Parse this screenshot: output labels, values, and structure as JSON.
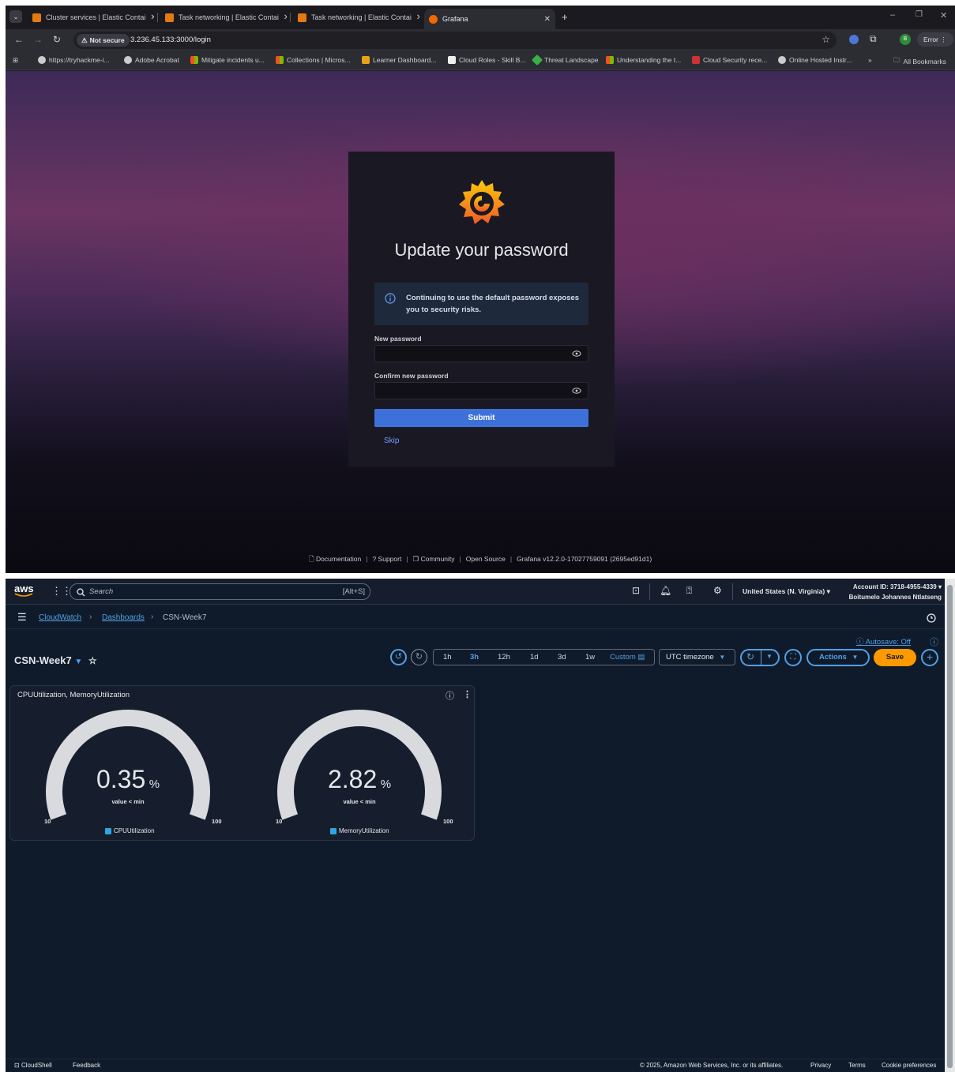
{
  "browser": {
    "tabs": [
      {
        "title": "Cluster services | Elastic Contai",
        "active": false
      },
      {
        "title": "Task networking | Elastic Contai",
        "active": false
      },
      {
        "title": "Task networking | Elastic Contai",
        "active": false
      },
      {
        "title": "Grafana",
        "active": true
      }
    ],
    "new_tab": "+",
    "address": {
      "security_label": "Not secure",
      "url": "3.236.45.133:3000/login"
    },
    "profile_initial": "B",
    "error_label": "Error",
    "bookmarks": [
      "https://tryhackme-i...",
      "Adobe Acrobat",
      "Mitigate incidents u...",
      "Collections | Micros...",
      "Learner Dashboard...",
      "Cloud Roles - Skill B...",
      "Threat Landscape",
      "Understanding the t...",
      "Cloud Security rece...",
      "Online Hosted Instr..."
    ],
    "bookmarks_overflow": "»",
    "all_bookmarks": "All Bookmarks"
  },
  "grafana": {
    "title": "Update your password",
    "alert": "Continuing to use the default password exposes you to security risks.",
    "new_password_label": "New password",
    "confirm_password_label": "Confirm new password",
    "submit_label": "Submit",
    "skip_label": "Skip",
    "footer": {
      "documentation": "Documentation",
      "support": "Support",
      "community": "Community",
      "open_source": "Open Source",
      "version": "Grafana v12.2.0-17027759091 (2695ed91d1)"
    }
  },
  "aws": {
    "logo": "aws",
    "search_placeholder": "Search",
    "search_shortcut": "[Alt+S]",
    "region": "United States (N. Virginia)",
    "account_id": "Account ID: 3718-4955-4339",
    "account_user": "Boitumelo Johannes Ntlatseng",
    "breadcrumb": {
      "service": "CloudWatch",
      "section": "Dashboards",
      "current": "CSN-Week7"
    },
    "dashboard_title": "CSN-Week7",
    "autosave": "Autosave: Off",
    "time_ranges": [
      "1h",
      "3h",
      "12h",
      "1d",
      "3d",
      "1w"
    ],
    "time_range_selected": "3h",
    "custom_label": "Custom",
    "timezone": "UTC timezone",
    "actions_label": "Actions",
    "save_label": "Save",
    "widget": {
      "title": "CPUUtilization, MemoryUtilization",
      "gauges": [
        {
          "value": "0.35",
          "unit": "%",
          "sub": "value < min",
          "min": "10",
          "max": "100",
          "legend": "CPUUtilization",
          "level": 0.0
        },
        {
          "value": "2.82",
          "unit": "%",
          "sub": "value < min",
          "min": "10",
          "max": "100",
          "legend": "MemoryUtilization",
          "level": 0.0
        }
      ]
    },
    "footer": {
      "cloudshell": "CloudShell",
      "feedback": "Feedback",
      "copyright": "© 2025, Amazon Web Services, Inc. or its affiliates.",
      "privacy": "Privacy",
      "terms": "Terms",
      "cookies": "Cookie preferences"
    }
  },
  "colors": {
    "aws_accent": "#539fe5",
    "aws_orange": "#ff9900",
    "grafana_blue": "#3d71d9"
  }
}
